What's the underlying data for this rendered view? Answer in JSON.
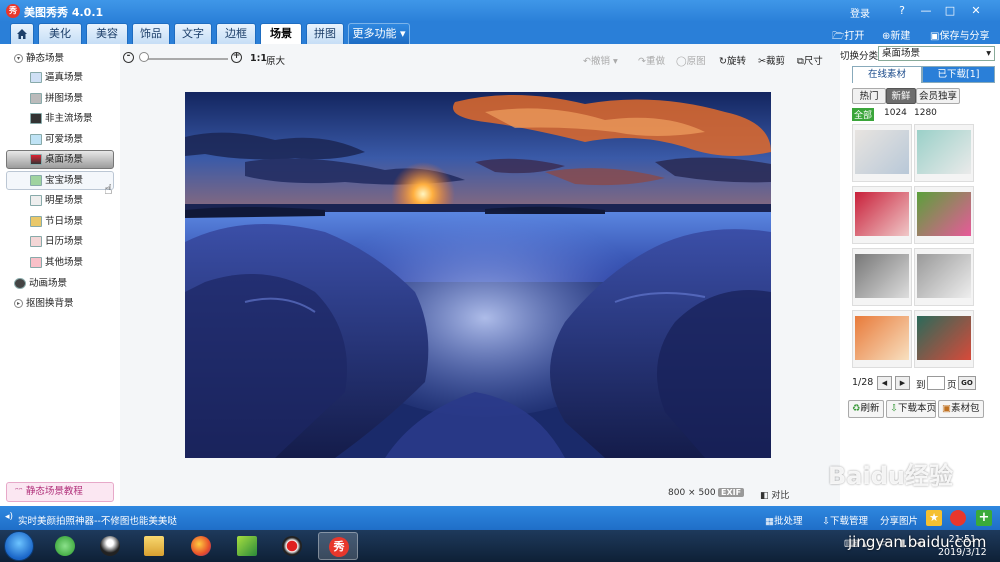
{
  "app": {
    "title": "美图秀秀 4.0.1",
    "logo_text": "秀",
    "login": "登录"
  },
  "window_controls": [
    "?",
    "—",
    "□",
    "✕"
  ],
  "menu": {
    "tabs": [
      "美化",
      "美容",
      "饰品",
      "文字",
      "边框",
      "场景",
      "拼图"
    ],
    "more": "更多功能",
    "actions": {
      "open": "打开",
      "new": "新建",
      "save": "保存与分享"
    }
  },
  "left_tree": {
    "root": "静态场景",
    "items": [
      "逼真场景",
      "拼图场景",
      "非主流场景",
      "可爱场景",
      "桌面场景",
      "宝宝场景",
      "明星场景",
      "节日场景",
      "日历场景",
      "其他场景"
    ],
    "selected": "桌面场景",
    "animated": "动画场景",
    "cutout": "抠图换背景",
    "tutorial": "静态场景教程"
  },
  "toolbar": {
    "zoom_ratio": "1:1",
    "original_size": "原大",
    "undo": "撤销",
    "redo": "重做",
    "original_image": "原图",
    "rotate": "旋转",
    "crop": "裁剪",
    "size": "尺寸"
  },
  "canvas_info": {
    "dimensions": "800 × 500",
    "exif": "EXIF",
    "compare": "对比"
  },
  "right_panel": {
    "switch_label": "切换分类",
    "category": "桌面场景",
    "tabs": [
      "在线素材",
      "已下载[1]"
    ],
    "sort": [
      "热门",
      "新鲜",
      "会员独享"
    ],
    "resolution": [
      "全部",
      "1024",
      "1280"
    ],
    "page": "1/28",
    "goto_label": "到",
    "page_unit": "页",
    "go": "GO",
    "buttons": [
      "刷新",
      "下载本页",
      "素材包"
    ]
  },
  "status_bar": {
    "text": "实时美颜拍照神器--不修图也能美美哒",
    "batch": "批处理",
    "download": "下载管理",
    "share": "分享图片"
  },
  "taskbar": {
    "time": "21:51",
    "date": "2019/3/12"
  },
  "watermark": {
    "text": "Baidu经验",
    "url": "jingyan.baidu.com"
  },
  "colors": {
    "title_blue": "#2a7fd8",
    "active_sort": "#6d6d6d",
    "all_green": "#3aa53a",
    "tutorial_pink": "#b0307a"
  }
}
